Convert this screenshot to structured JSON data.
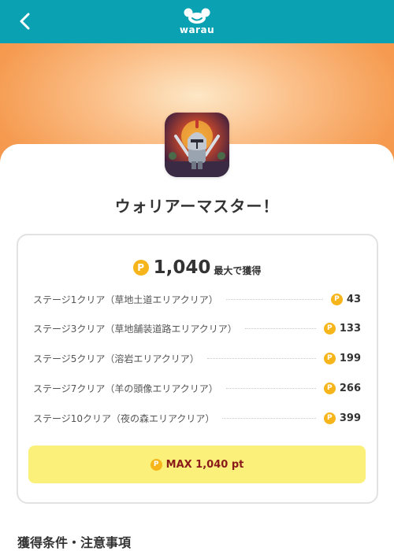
{
  "header": {
    "brand": "warau",
    "back_icon": "chevron-left-icon",
    "color": "#0aa1b2"
  },
  "app": {
    "title": "ウォリアーマスター！",
    "icon": "knight-app-icon"
  },
  "reward": {
    "coin_symbol": "P",
    "total": "1,040",
    "total_suffix": "最大で獲得",
    "steps": [
      {
        "label": "ステージ1クリア（草地土道エリアクリア）",
        "points": "43"
      },
      {
        "label": "ステージ3クリア（草地舗装道路エリアクリア）",
        "points": "133"
      },
      {
        "label": "ステージ5クリア（溶岩エリアクリア）",
        "points": "199"
      },
      {
        "label": "ステージ7クリア（羊の頭像エリアクリア）",
        "points": "266"
      },
      {
        "label": "ステージ10クリア（夜の森エリアクリア）",
        "points": "399"
      }
    ],
    "max_label": "MAX 1,040 pt",
    "coin_color": "#f6b51a",
    "max_bg": "#fbf07a"
  },
  "section": {
    "title": "獲得条件・注意事項"
  }
}
